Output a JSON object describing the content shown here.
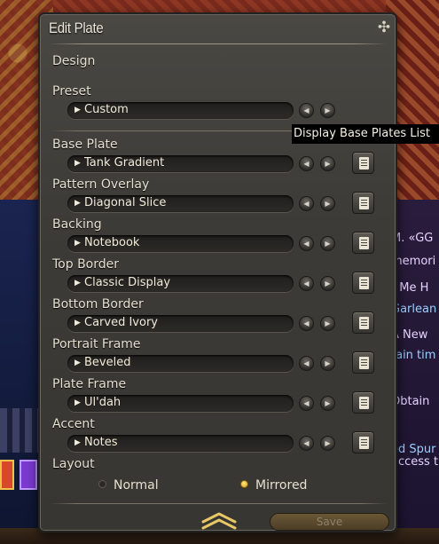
{
  "window": {
    "title": "Edit Plate",
    "close_icon": "close-icon"
  },
  "design": {
    "label": "Design",
    "preset": {
      "label": "Preset",
      "value": "Custom"
    }
  },
  "rows": [
    {
      "label": "Base Plate",
      "value": "Tank Gradient"
    },
    {
      "label": "Pattern Overlay",
      "value": "Diagonal Slice"
    },
    {
      "label": "Backing",
      "value": "Notebook"
    },
    {
      "label": "Top Border",
      "value": "Classic Display"
    },
    {
      "label": "Bottom Border",
      "value": "Carved Ivory"
    },
    {
      "label": "Portrait Frame",
      "value": "Beveled"
    },
    {
      "label": "Plate Frame",
      "value": "Ul'dah"
    },
    {
      "label": "Accent",
      "value": "Notes"
    }
  ],
  "layout": {
    "label": "Layout",
    "options": [
      "Normal",
      "Mirrored"
    ],
    "selected": "Mirrored"
  },
  "footer": {
    "save_label": "Save"
  },
  "tooltip": "Display Base Plates List",
  "background": {
    "fragments": [
      "M. «GG",
      "memori",
      "t Me H",
      "Garlean",
      "A New",
      "tain tim",
      "Obtain",
      "ed Spur",
      "access t"
    ]
  },
  "colors": {
    "accent_gold": "#e0a01c",
    "window_bg": "#3d3b37",
    "save_bg": "#5a4a2e"
  }
}
